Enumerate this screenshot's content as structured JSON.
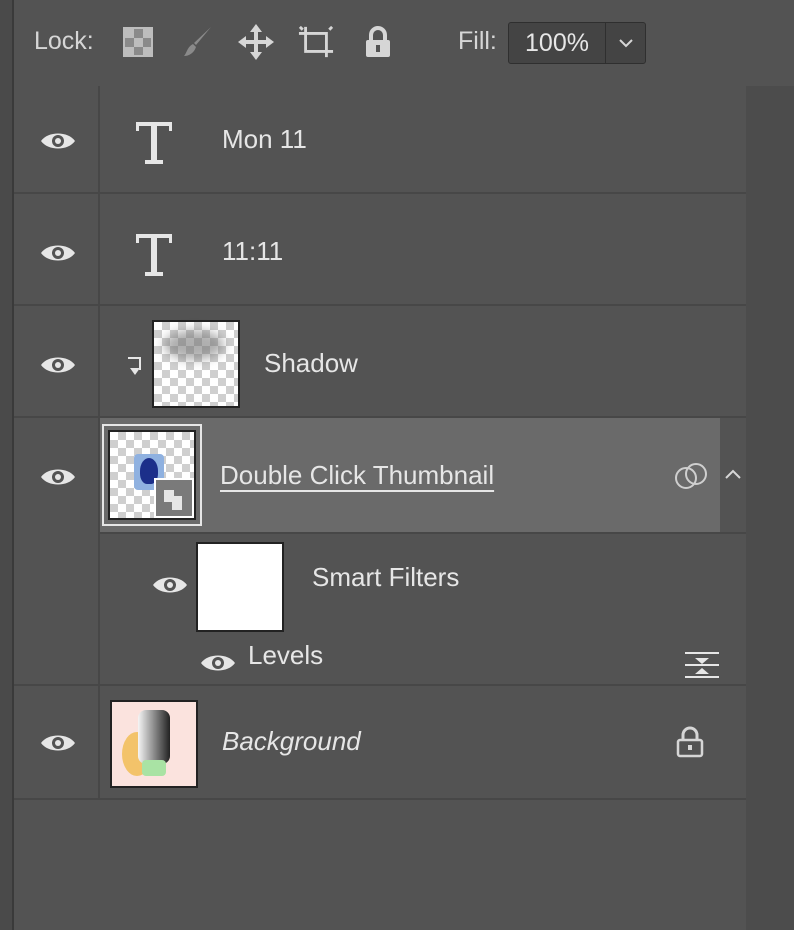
{
  "toolbar": {
    "lock_label": "Lock:",
    "lock_icons": [
      "lock-transparent-pixels-icon",
      "lock-image-pixels-icon",
      "lock-position-icon",
      "lock-artboard-icon",
      "lock-all-icon"
    ],
    "fill_label": "Fill:",
    "fill_value": "100%"
  },
  "layers": [
    {
      "name": "Mon 11",
      "type": "text",
      "visible": true
    },
    {
      "name": "11:11",
      "type": "text",
      "visible": true
    },
    {
      "name": "Shadow",
      "type": "clipped-layer",
      "visible": true
    },
    {
      "name": "Double Click Thumbnail",
      "type": "smart-object",
      "visible": true,
      "selected": true,
      "smart_filters": {
        "label": "Smart Filters",
        "filters": [
          {
            "name": "Levels"
          }
        ]
      }
    },
    {
      "name": "Background",
      "type": "background",
      "visible": true,
      "locked": true
    }
  ],
  "colors": {
    "panel": "#535353",
    "selected": "#6a6a6a",
    "text": "#e6e6e6"
  }
}
